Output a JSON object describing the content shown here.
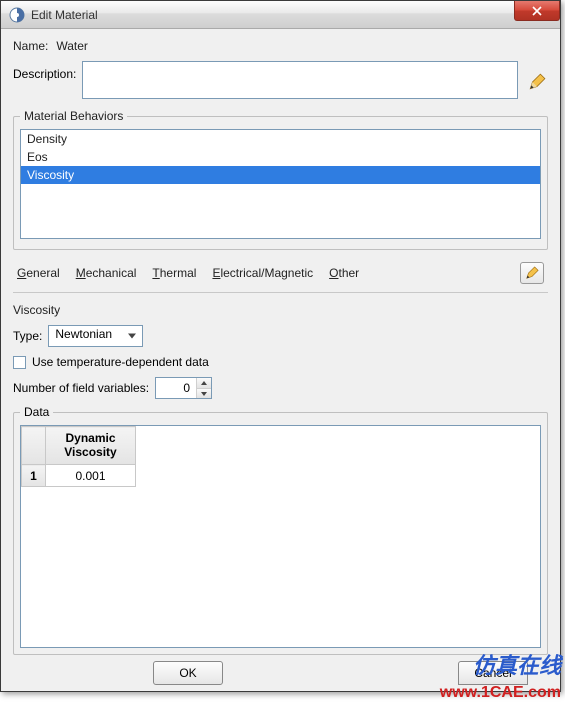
{
  "window": {
    "title": "Edit Material"
  },
  "form": {
    "name_label": "Name:",
    "name_value": "Water",
    "description_label": "Description:",
    "description_value": ""
  },
  "behaviors": {
    "legend": "Material Behaviors",
    "items": [
      "Density",
      "Eos",
      "Viscosity"
    ],
    "selected_index": 2
  },
  "menu": {
    "general": "General",
    "mechanical": "Mechanical",
    "thermal": "Thermal",
    "electrical": "Electrical/Magnetic",
    "other": "Other"
  },
  "viscosity": {
    "title": "Viscosity",
    "type_label": "Type:",
    "type_value": "Newtonian",
    "temp_dep_label": "Use temperature-dependent data",
    "temp_dep_checked": false,
    "field_vars_label": "Number of field variables:",
    "field_vars_value": "0"
  },
  "data": {
    "legend": "Data",
    "col_header": "Dynamic\nViscosity",
    "rows": [
      {
        "index": "1",
        "value": "0.001"
      }
    ]
  },
  "buttons": {
    "ok": "OK",
    "cancel": "Cancel"
  },
  "watermark": {
    "cn": "仿真在线",
    "url": "www.1CAE.com"
  }
}
